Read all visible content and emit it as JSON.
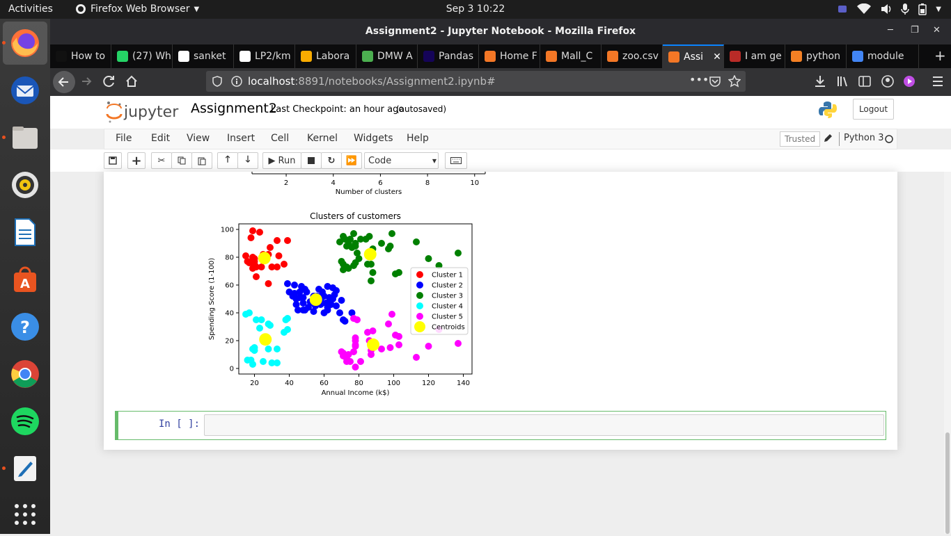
{
  "topbar": {
    "activities": "Activities",
    "app_name": "Firefox Web Browser",
    "clock": "Sep 3  10:22"
  },
  "window": {
    "title": "Assignment2 - Jupyter Notebook - Mozilla Firefox"
  },
  "tabs": [
    {
      "label": "How to",
      "icon_color": "#111111"
    },
    {
      "label": "(27) Wh",
      "icon_color": "#25d366"
    },
    {
      "label": "sanket",
      "icon_color": "#ffffff"
    },
    {
      "label": "LP2/km",
      "icon_color": "#ffffff"
    },
    {
      "label": "Labora",
      "icon_color": "#f9ab00"
    },
    {
      "label": "DMW A",
      "icon_color": "#4caf50"
    },
    {
      "label": "Pandas",
      "icon_color": "#150458"
    },
    {
      "label": "Home F",
      "icon_color": "#f37726"
    },
    {
      "label": "Mall_C",
      "icon_color": "#f37726"
    },
    {
      "label": "zoo.csv",
      "icon_color": "#f37726"
    },
    {
      "label": "Assi",
      "icon_color": "#f37726",
      "active": true
    },
    {
      "label": "I am ge",
      "icon_color": "#b92b27"
    },
    {
      "label": "python",
      "icon_color": "#f48024"
    },
    {
      "label": "module",
      "icon_color": "#4285f4"
    }
  ],
  "urlbar": {
    "host": "localhost",
    "rest": ":8891/notebooks/Assignment2.ipynb#"
  },
  "jupyter": {
    "logo": "jupyter",
    "notebook_name": "Assignment2",
    "checkpoint": "Last Checkpoint: an hour ago",
    "autosaved": "(autosaved)",
    "logout": "Logout",
    "menus": [
      "File",
      "Edit",
      "View",
      "Insert",
      "Cell",
      "Kernel",
      "Widgets",
      "Help"
    ],
    "trusted": "Trusted",
    "kernel": "Python 3",
    "run_label": "Run",
    "cell_type": "Code",
    "prompt": "In [ ]:"
  },
  "chart_data": [
    {
      "type": "line",
      "xlabel": "Number of clusters",
      "xticks": [
        2,
        4,
        6,
        8,
        10
      ],
      "xlim": [
        0.55,
        10.45
      ]
    },
    {
      "type": "scatter",
      "title": "Clusters of customers",
      "xlabel": "Annual Income (k$)",
      "ylabel": "Spending Score (1-100)",
      "xlim": [
        11,
        145
      ],
      "ylim": [
        -4,
        104
      ],
      "xticks": [
        20,
        40,
        60,
        80,
        100,
        120,
        140
      ],
      "yticks": [
        0,
        20,
        40,
        60,
        80,
        100
      ],
      "legend_position": "center-right",
      "series": [
        {
          "name": "Cluster 1",
          "color": "#ff0000",
          "points": [
            [
              15,
              81
            ],
            [
              16,
              77
            ],
            [
              17,
              76
            ],
            [
              18,
              94
            ],
            [
              19,
              72
            ],
            [
              19,
              99
            ],
            [
              20,
              77
            ],
            [
              20,
              79
            ],
            [
              21,
              73
            ],
            [
              21,
              66
            ],
            [
              23,
              98
            ],
            [
              24,
              73
            ],
            [
              25,
              82
            ],
            [
              28,
              82
            ],
            [
              28,
              61
            ],
            [
              29,
              87
            ],
            [
              30,
              73
            ],
            [
              33,
              73
            ],
            [
              33,
              92
            ],
            [
              34,
              81
            ],
            [
              37,
              75
            ],
            [
              39,
              92
            ],
            [
              20,
              75
            ],
            [
              19,
              80
            ]
          ]
        },
        {
          "name": "Cluster 2",
          "color": "#0000ff",
          "points": [
            [
              39,
              61
            ],
            [
              40,
              55
            ],
            [
              42,
              52
            ],
            [
              43,
              54
            ],
            [
              43,
              60
            ],
            [
              44,
              46
            ],
            [
              46,
              51
            ],
            [
              46,
              55
            ],
            [
              47,
              59
            ],
            [
              48,
              51
            ],
            [
              48,
              42
            ],
            [
              48,
              47
            ],
            [
              49,
              42
            ],
            [
              50,
              55
            ],
            [
              54,
              52
            ],
            [
              54,
              47
            ],
            [
              54,
              41
            ],
            [
              57,
              51
            ],
            [
              58,
              46
            ],
            [
              59,
              55
            ],
            [
              60,
              40
            ],
            [
              60,
              52
            ],
            [
              62,
              59
            ],
            [
              62,
              42
            ],
            [
              63,
              51
            ],
            [
              63,
              48
            ],
            [
              64,
              46
            ],
            [
              65,
              50
            ],
            [
              65,
              58
            ],
            [
              67,
              45
            ],
            [
              67,
              56
            ],
            [
              69,
              40
            ],
            [
              71,
              35
            ],
            [
              72,
              34
            ],
            [
              76,
              40
            ],
            [
              55,
              45
            ],
            [
              52,
              48
            ],
            [
              45,
              42
            ],
            [
              57,
              57
            ],
            [
              61,
              47
            ],
            [
              66,
              53
            ],
            [
              70,
              49
            ],
            [
              58,
              49
            ],
            [
              51,
              44
            ],
            [
              62,
              44
            ],
            [
              44,
              50
            ],
            [
              49,
              57
            ],
            [
              56,
              52
            ]
          ]
        },
        {
          "name": "Cluster 3",
          "color": "#008000",
          "points": [
            [
              69,
              91
            ],
            [
              70,
              77
            ],
            [
              71,
              95
            ],
            [
              71,
              75
            ],
            [
              71,
              71
            ],
            [
              72,
              93
            ],
            [
              73,
              88
            ],
            [
              73,
              73
            ],
            [
              74,
              72
            ],
            [
              75,
              93
            ],
            [
              76,
              87
            ],
            [
              77,
              97
            ],
            [
              77,
              74
            ],
            [
              78,
              90
            ],
            [
              78,
              76
            ],
            [
              78,
              88
            ],
            [
              79,
              83
            ],
            [
              81,
              93
            ],
            [
              85,
              75
            ],
            [
              86,
              95
            ],
            [
              87,
              63
            ],
            [
              87,
              75
            ],
            [
              88,
              69
            ],
            [
              88,
              86
            ],
            [
              93,
              90
            ],
            [
              97,
              86
            ],
            [
              98,
              88
            ],
            [
              99,
              97
            ],
            [
              101,
              68
            ],
            [
              103,
              69
            ],
            [
              113,
              91
            ],
            [
              120,
              79
            ],
            [
              126,
              74
            ],
            [
              137,
              83
            ],
            [
              74,
              90
            ],
            [
              80,
              79
            ],
            [
              84,
              93
            ]
          ]
        },
        {
          "name": "Cluster 4",
          "color": "#00ffff",
          "points": [
            [
              15,
              39
            ],
            [
              16,
              6
            ],
            [
              17,
              40
            ],
            [
              18,
              6
            ],
            [
              19,
              3
            ],
            [
              19,
              14
            ],
            [
              20,
              15
            ],
            [
              20,
              13
            ],
            [
              21,
              35
            ],
            [
              23,
              29
            ],
            [
              24,
              35
            ],
            [
              25,
              5
            ],
            [
              28,
              14
            ],
            [
              28,
              32
            ],
            [
              29,
              31
            ],
            [
              30,
              4
            ],
            [
              33,
              4
            ],
            [
              33,
              14
            ],
            [
              37,
              26
            ],
            [
              38,
              35
            ],
            [
              39,
              28
            ],
            [
              39,
              36
            ]
          ]
        },
        {
          "name": "Cluster 5",
          "color": "#ff00ff",
          "points": [
            [
              70,
              12
            ],
            [
              71,
              11
            ],
            [
              71,
              9
            ],
            [
              73,
              5
            ],
            [
              73,
              7
            ],
            [
              74,
              10
            ],
            [
              75,
              5
            ],
            [
              77,
              12
            ],
            [
              77,
              36
            ],
            [
              78,
              17
            ],
            [
              78,
              22
            ],
            [
              78,
              20
            ],
            [
              78,
              1
            ],
            [
              78,
              16
            ],
            [
              79,
              35
            ],
            [
              81,
              5
            ],
            [
              85,
              26
            ],
            [
              86,
              20
            ],
            [
              87,
              10
            ],
            [
              87,
              13
            ],
            [
              88,
              15
            ],
            [
              88,
              27
            ],
            [
              93,
              14
            ],
            [
              97,
              32
            ],
            [
              98,
              15
            ],
            [
              99,
              39
            ],
            [
              101,
              24
            ],
            [
              103,
              23
            ],
            [
              103,
              17
            ],
            [
              113,
              8
            ],
            [
              120,
              16
            ],
            [
              126,
              28
            ],
            [
              137,
              18
            ]
          ]
        },
        {
          "name": "Centroids",
          "color": "#ffff00",
          "points": [
            [
              25.7,
              79.4
            ],
            [
              55.3,
              49.5
            ],
            [
              86.5,
              82.1
            ],
            [
              26.3,
              20.9
            ],
            [
              88.2,
              17.1
            ]
          ]
        }
      ]
    }
  ]
}
